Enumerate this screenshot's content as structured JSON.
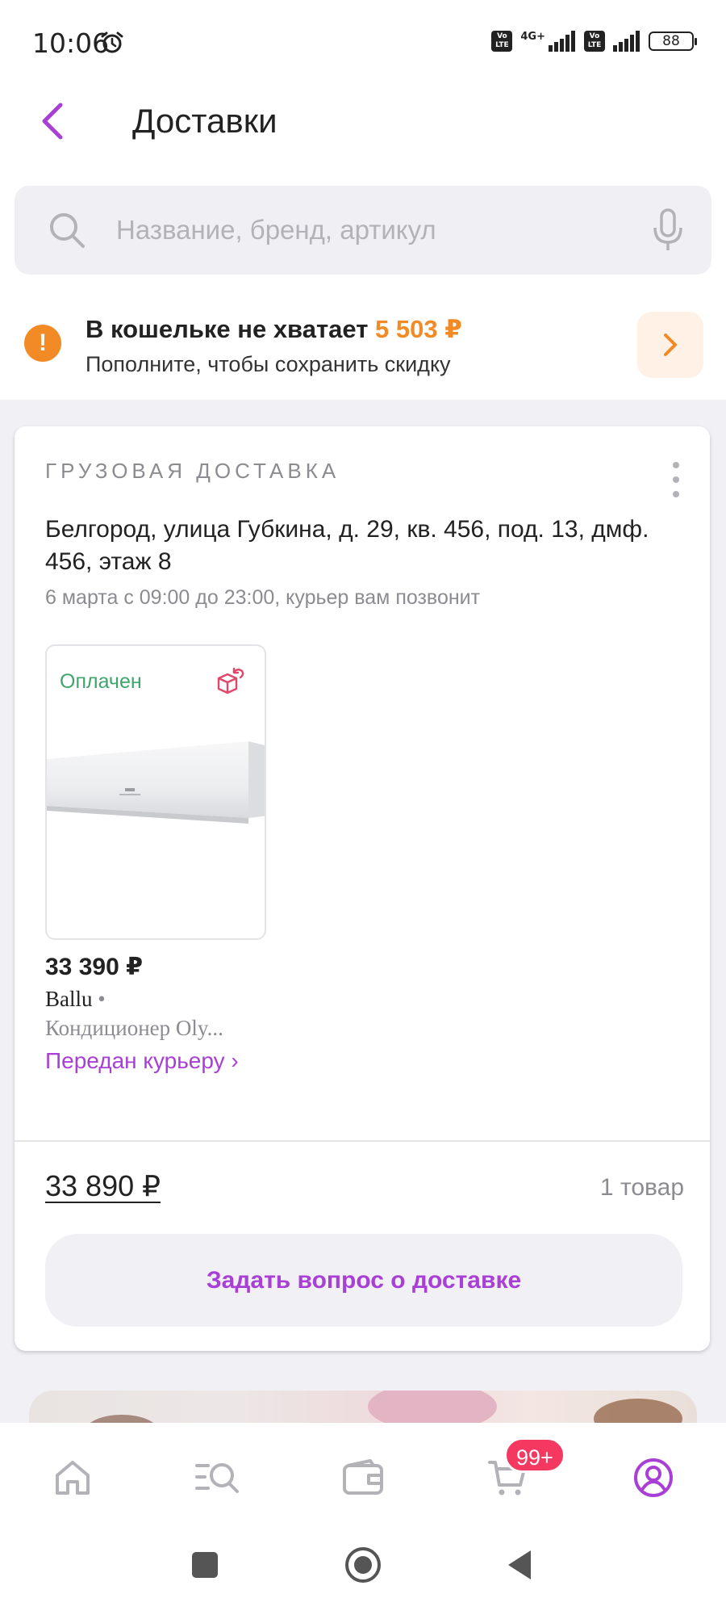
{
  "status_bar": {
    "time": "10:06",
    "network": "4G+",
    "volte": "Vo LTE",
    "battery": "88"
  },
  "header": {
    "title": "Доставки"
  },
  "search": {
    "placeholder": "Название, бренд, артикул"
  },
  "wallet_banner": {
    "title_prefix": "В кошельке не хватает ",
    "amount": "5 503 ₽",
    "subtitle": "Пополните, чтобы сохранить скидку",
    "accent_color": "#f28a25"
  },
  "delivery": {
    "type_label": "ГРУЗОВАЯ ДОСТАВКА",
    "address": "Белгород, улица Губкина, д. 29, кв. 456, под. 13, дмф. 456, этаж 8",
    "schedule": "6 марта с 09:00 до 23:00, курьер вам позвонит",
    "product": {
      "badge": "Оплачен",
      "price": "33 390 ₽",
      "brand": "Ballu",
      "brand_separator": "•",
      "name": "Кондиционер Oly...",
      "status_link": "Передан курьеру ›"
    },
    "total": "33 890 ₽",
    "items_count": "1 товар",
    "ask_button": "Задать вопрос о доставке",
    "accent_color": "#a840d5"
  },
  "bottom_nav": {
    "items": [
      {
        "icon": "home-icon"
      },
      {
        "icon": "catalog-search-icon"
      },
      {
        "icon": "wallet-icon"
      },
      {
        "icon": "cart-icon",
        "badge": "99+"
      },
      {
        "icon": "profile-icon",
        "active": true
      }
    ]
  },
  "system_nav": {
    "buttons": [
      "recents-icon",
      "home-circle-icon",
      "back-triangle-icon"
    ]
  }
}
